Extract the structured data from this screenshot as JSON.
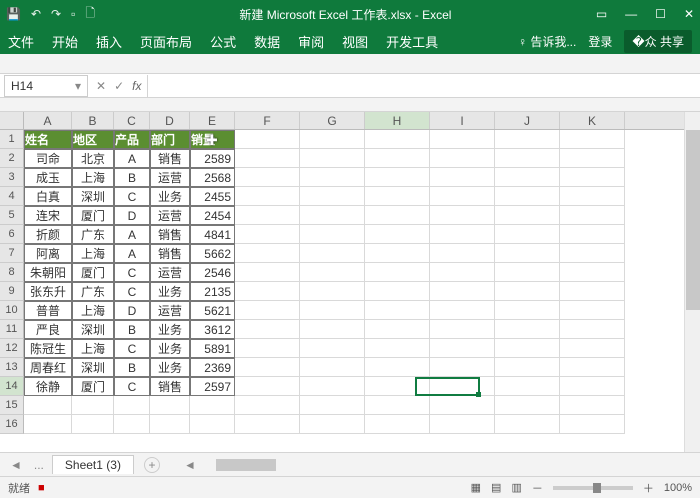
{
  "titlebar": {
    "title": "新建 Microsoft Excel 工作表.xlsx - Excel"
  },
  "ribbon": {
    "tabs": [
      "文件",
      "开始",
      "插入",
      "页面布局",
      "公式",
      "数据",
      "审阅",
      "视图",
      "开发工具"
    ],
    "tell_me": "告诉我...",
    "login": "登录",
    "share": "共享"
  },
  "namebox": {
    "value": "H14"
  },
  "columns": [
    "A",
    "B",
    "C",
    "D",
    "E",
    "F",
    "G",
    "H",
    "I",
    "J",
    "K"
  ],
  "rows": [
    1,
    2,
    3,
    4,
    5,
    6,
    7,
    8,
    9,
    10,
    11,
    12,
    13,
    14,
    15,
    16
  ],
  "table": {
    "headers": [
      "姓名",
      "地区",
      "产品",
      "部门",
      "销量"
    ],
    "data": [
      [
        "司命",
        "北京",
        "A",
        "销售",
        "2589"
      ],
      [
        "成玉",
        "上海",
        "B",
        "运营",
        "2568"
      ],
      [
        "白真",
        "深圳",
        "C",
        "业务",
        "2455"
      ],
      [
        "连宋",
        "厦门",
        "D",
        "运营",
        "2454"
      ],
      [
        "折颜",
        "广东",
        "A",
        "销售",
        "4841"
      ],
      [
        "阿离",
        "上海",
        "A",
        "销售",
        "5662"
      ],
      [
        "朱朝阳",
        "厦门",
        "C",
        "运营",
        "2546"
      ],
      [
        "张东升",
        "广东",
        "C",
        "业务",
        "2135"
      ],
      [
        "普普",
        "上海",
        "D",
        "运营",
        "5621"
      ],
      [
        "严良",
        "深圳",
        "B",
        "业务",
        "3612"
      ],
      [
        "陈冠生",
        "上海",
        "C",
        "业务",
        "5891"
      ],
      [
        "周春红",
        "深圳",
        "B",
        "业务",
        "2369"
      ],
      [
        "徐静",
        "厦门",
        "C",
        "销售",
        "2597"
      ]
    ]
  },
  "sheet": {
    "name": "Sheet1 (3)"
  },
  "status": {
    "ready": "就绪",
    "rec": "■",
    "zoom": "100%"
  },
  "selection": {
    "row": 14,
    "col": "H"
  }
}
